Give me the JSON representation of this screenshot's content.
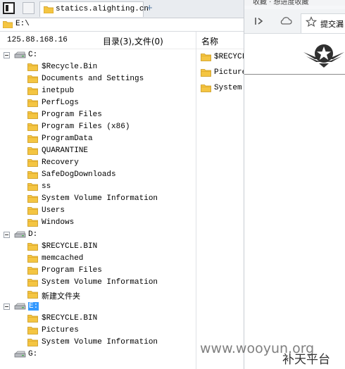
{
  "tabbar": {
    "tab_label": "statics.alighting.cn",
    "new_tab": "+"
  },
  "address": {
    "path": "E:\\"
  },
  "left": {
    "ip": "125.88.168.16",
    "summary": "目录(3),文件(0)",
    "tree": [
      {
        "kind": "drive",
        "label": "C:",
        "selected": false
      },
      {
        "kind": "folder",
        "label": "$Recycle.Bin"
      },
      {
        "kind": "folder",
        "label": "Documents and Settings"
      },
      {
        "kind": "folder",
        "label": "inetpub"
      },
      {
        "kind": "folder",
        "label": "PerfLogs"
      },
      {
        "kind": "folder",
        "label": "Program Files"
      },
      {
        "kind": "folder",
        "label": "Program Files (x86)"
      },
      {
        "kind": "folder",
        "label": "ProgramData"
      },
      {
        "kind": "folder",
        "label": "QUARANTINE"
      },
      {
        "kind": "folder",
        "label": "Recovery"
      },
      {
        "kind": "folder",
        "label": "SafeDogDownloads"
      },
      {
        "kind": "folder",
        "label": "ss"
      },
      {
        "kind": "folder",
        "label": "System Volume Information"
      },
      {
        "kind": "folder",
        "label": "Users"
      },
      {
        "kind": "folder",
        "label": "Windows"
      },
      {
        "kind": "drive",
        "label": "D:",
        "selected": false
      },
      {
        "kind": "folder",
        "label": "$RECYCLE.BIN"
      },
      {
        "kind": "folder",
        "label": "memcached"
      },
      {
        "kind": "folder",
        "label": "Program Files"
      },
      {
        "kind": "folder",
        "label": "System Volume Information"
      },
      {
        "kind": "folder",
        "label": "新建文件夹"
      },
      {
        "kind": "drive",
        "label": "E:",
        "selected": true
      },
      {
        "kind": "folder",
        "label": "$RECYCLE.BIN"
      },
      {
        "kind": "folder",
        "label": "Pictures"
      },
      {
        "kind": "folder",
        "label": "System Volume Information"
      },
      {
        "kind": "drive",
        "label": "G:",
        "selected": false
      }
    ]
  },
  "right": {
    "header": "名称",
    "items": [
      "$RECYCLE.BIN",
      "Pictures",
      "System Volume Information"
    ]
  },
  "browser": {
    "favorites_text": "收藏  ·  想进度收藏",
    "tab_label": "提交漏",
    "back_icon": "sidebar-toggle-icon",
    "cloud_icon": "cloud-icon"
  },
  "watermark": {
    "site": "www.wooyun.org",
    "platform": "补天平台"
  },
  "colors": {
    "folder": "#f4c542",
    "selection": "#3399ff",
    "tabbar": "#e9ecf0"
  }
}
